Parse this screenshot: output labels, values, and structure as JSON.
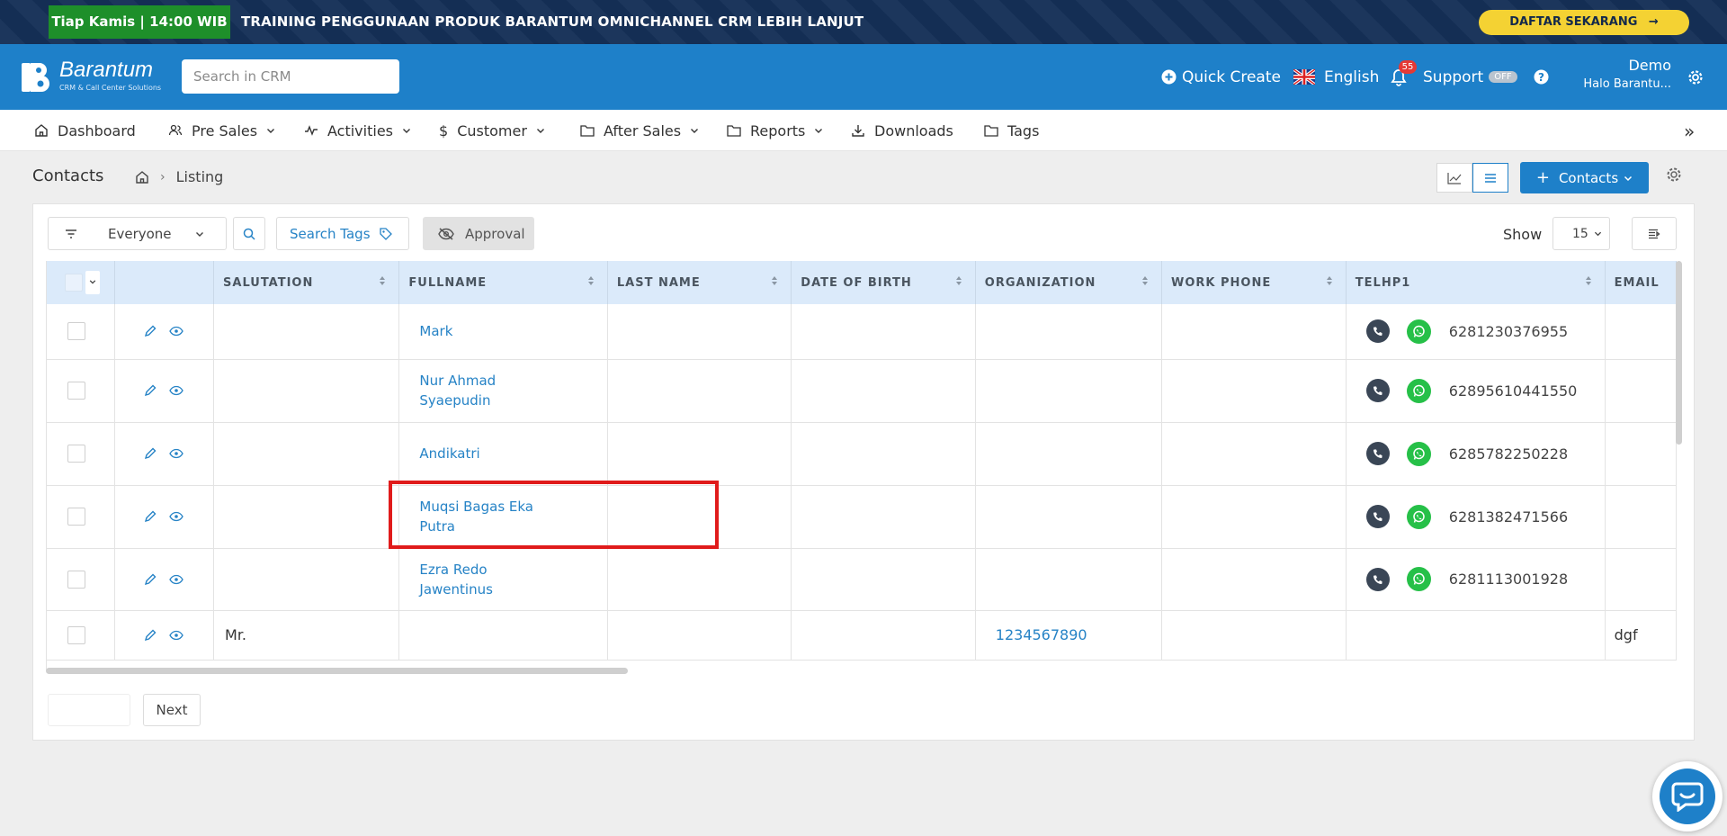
{
  "promo": {
    "tag": "Tiap Kamis | 14:00 WIB",
    "text": "TRAINING PENGGUNAAN PRODUK BARANTUM OMNICHANNEL CRM LEBIH LANJUT",
    "cta": "DAFTAR SEKARANG"
  },
  "header": {
    "logo_name": "Barantum",
    "logo_sub": "CRM & Call Center Solutions",
    "search_placeholder": "Search in CRM",
    "quick_create": "Quick Create",
    "language": "English",
    "notification_count": "55",
    "support": "Support",
    "support_status": "OFF",
    "user_name": "Demo",
    "user_sub": "Halo Barantu..."
  },
  "nav": {
    "items": [
      {
        "label": "Dashboard",
        "icon": "home-icon"
      },
      {
        "label": "Pre Sales",
        "icon": "users-icon"
      },
      {
        "label": "Activities",
        "icon": "activity-icon"
      },
      {
        "label": "Customer",
        "icon": "dollar-icon"
      },
      {
        "label": "After Sales",
        "icon": "folder-icon"
      },
      {
        "label": "Reports",
        "icon": "folder-icon"
      },
      {
        "label": "Downloads",
        "icon": "download-icon"
      },
      {
        "label": "Tags",
        "icon": "folder-icon"
      }
    ]
  },
  "page": {
    "title": "Contacts",
    "breadcrumb_current": "Listing",
    "add_button": "Contacts"
  },
  "filters": {
    "owner": "Everyone",
    "search_tags": "Search Tags",
    "approval": "Approval",
    "show_label": "Show",
    "page_size": "15"
  },
  "table": {
    "columns": [
      "SALUTATION",
      "FULLNAME",
      "LAST NAME",
      "DATE OF BIRTH",
      "ORGANIZATION",
      "WORK PHONE",
      "TELHP1",
      "EMAIL"
    ],
    "rows": [
      {
        "salutation": "",
        "fullname": "Mark",
        "last_name": "",
        "dob": "",
        "organization": "",
        "work_phone": "",
        "telhp1": "6281230376955",
        "email": ""
      },
      {
        "salutation": "",
        "fullname": "Nur Ahmad Syaepudin",
        "last_name": "",
        "dob": "",
        "organization": "",
        "work_phone": "",
        "telhp1": "62895610441550",
        "email": ""
      },
      {
        "salutation": "",
        "fullname": "Andikatri",
        "last_name": "",
        "dob": "",
        "organization": "",
        "work_phone": "",
        "telhp1": "6285782250228",
        "email": ""
      },
      {
        "salutation": "",
        "fullname": "Muqsi Bagas Eka Putra",
        "last_name": "",
        "dob": "",
        "organization": "",
        "work_phone": "",
        "telhp1": "6281382471566",
        "email": ""
      },
      {
        "salutation": "",
        "fullname": "Ezra Redo Jawentinus",
        "last_name": "",
        "dob": "",
        "organization": "",
        "work_phone": "",
        "telhp1": "6281113001928",
        "email": ""
      },
      {
        "salutation": "Mr.",
        "fullname": "",
        "last_name": "",
        "dob": "",
        "organization": "1234567890",
        "work_phone": "",
        "telhp1": "",
        "email": "dgf"
      }
    ]
  },
  "pagination": {
    "next": "Next"
  },
  "colors": {
    "primary": "#1e80c9",
    "banner": "#153057",
    "promo_tag": "#1e8f2a",
    "cta": "#f4d233",
    "link": "#2683c6",
    "highlight": "#e01b1b",
    "whatsapp": "#26c048"
  }
}
